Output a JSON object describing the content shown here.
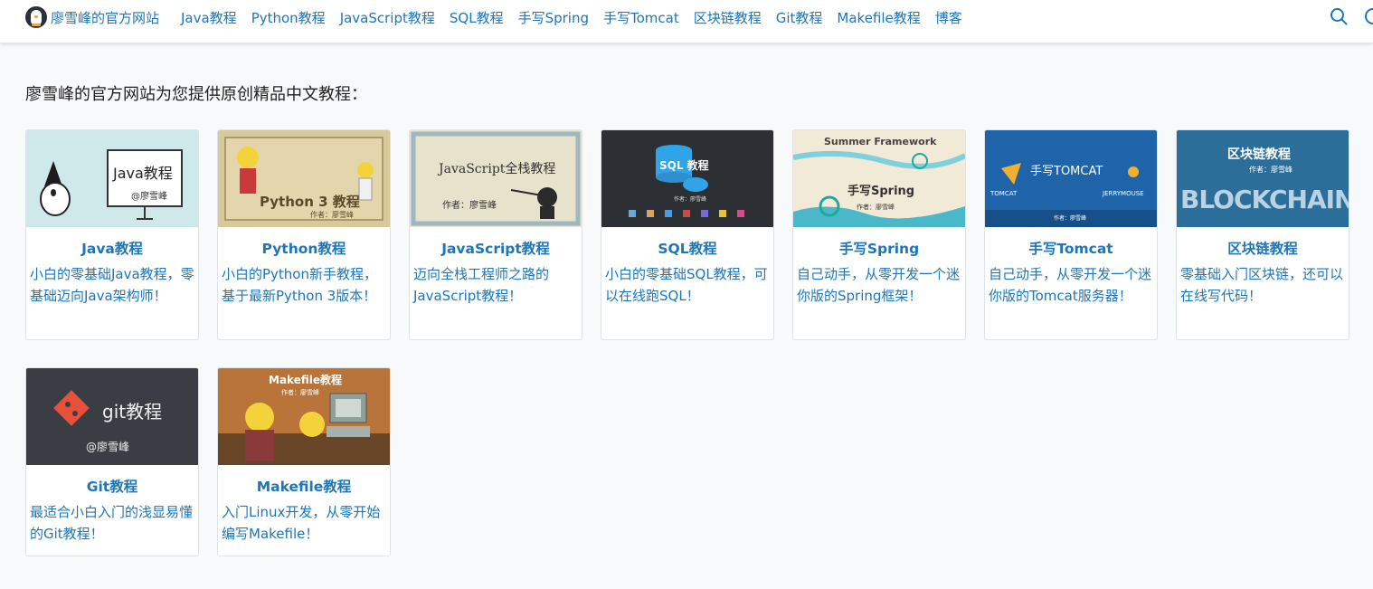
{
  "header": {
    "brand": "廖雪峰的官方网站",
    "nav": [
      "Java教程",
      "Python教程",
      "JavaScript教程",
      "SQL教程",
      "手写Spring",
      "手写Tomcat",
      "区块链教程",
      "Git教程",
      "Makefile教程",
      "博客"
    ]
  },
  "intro": "廖雪峰的官方网站为您提供原创精品中文教程：",
  "cards": [
    {
      "title": "Java教程",
      "desc": "小白的零基础Java教程，零基础迈向Java架构师！",
      "thumb": {
        "main": "Java教程",
        "sub": "@廖雪峰"
      }
    },
    {
      "title": "Python教程",
      "desc": "小白的Python新手教程，基于最新Python 3版本！",
      "thumb": {
        "main": "Python 3 教程",
        "sub": "作者：廖雪峰"
      }
    },
    {
      "title": "JavaScript教程",
      "desc": "迈向全栈工程师之路的JavaScript教程！",
      "thumb": {
        "main": "JavaScript全栈教程",
        "sub": "作者：廖雪峰"
      }
    },
    {
      "title": "SQL教程",
      "desc": "小白的零基础SQL教程，可以在线跑SQL！",
      "thumb": {
        "main": "SQL 教程",
        "sub": "作者：廖雪峰"
      }
    },
    {
      "title": "手写Spring",
      "desc": "自己动手，从零开发一个迷你版的Spring框架！",
      "thumb": {
        "main": "手写Spring",
        "top": "Summer Framework",
        "sub": "作者：廖雪峰"
      }
    },
    {
      "title": "手写Tomcat",
      "desc": "自己动手，从零开发一个迷你版的Tomcat服务器！",
      "thumb": {
        "main": "手写TOMCAT",
        "left": "TOMCAT",
        "right": "JERRYMOUSE",
        "sub": "作者：廖雪峰"
      }
    },
    {
      "title": "区块链教程",
      "desc": "零基础入门区块链，还可以在线写代码！",
      "thumb": {
        "main": "区块链教程",
        "sub": "作者：廖雪峰",
        "word": "BLOCKCHAIN"
      }
    },
    {
      "title": "Git教程",
      "desc": "最适合小白入门的浅显易懂的Git教程！",
      "thumb": {
        "main": "git教程",
        "sub": "@廖雪峰"
      }
    },
    {
      "title": "Makefile教程",
      "desc": "入门Linux开发，从零开始编写Makefile！",
      "thumb": {
        "main": "Makefile教程",
        "sub": "作者：廖雪峰"
      }
    }
  ]
}
